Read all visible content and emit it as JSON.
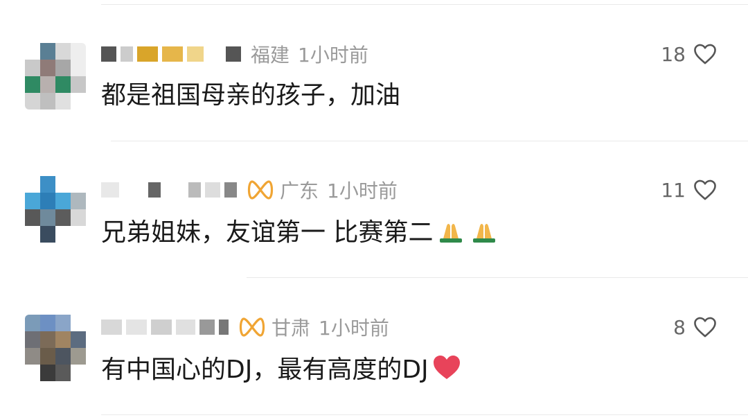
{
  "comments": [
    {
      "location": "福建",
      "time": "1小时前",
      "text": "都是祖国母亲的孩子，加油",
      "likes": "18",
      "has_badge": false,
      "emoji": "",
      "avatar_colors": [
        "#ffffff",
        "#5a7f94",
        "#d8d8d8",
        "#eeeeee",
        "#c9c9c9",
        "#8f7b78",
        "#a7a7a7",
        "#eeeeee",
        "#2f8a63",
        "#b8b0ae",
        "#2f8a63",
        "#c7c7c7",
        "#d5d5d5",
        "#bfbfbf",
        "#e0e0e0",
        "#ffffff"
      ]
    },
    {
      "location": "广东",
      "time": "1小时前",
      "text": "兄弟姐妹，友谊第一 比赛第二",
      "likes": "11",
      "has_badge": true,
      "emoji": "folded-hands",
      "avatar_colors": [
        "#ffffff",
        "#3d8fc6",
        "#ffffff",
        "#ffffff",
        "#4aa7d8",
        "#2d7eb7",
        "#4aa7d8",
        "#aeb8be",
        "#585858",
        "#6f8a9c",
        "#5c5c5c",
        "#d8d8d8",
        "#ffffff",
        "#3a4c5f",
        "#ffffff",
        "#ffffff"
      ]
    },
    {
      "location": "甘肃",
      "time": "1小时前",
      "text": "有中国心的DJ，最有高度的DJ",
      "likes": "8",
      "has_badge": true,
      "emoji": "heart",
      "avatar_colors": [
        "#7b9bb8",
        "#6d90c3",
        "#8aa5c8",
        "#ffffff",
        "#6e6f75",
        "#7c6b58",
        "#a08462",
        "#5c6c80",
        "#8f8b86",
        "#6a5c4a",
        "#4d5560",
        "#9d9a90",
        "#ffffff",
        "#3b3b3b",
        "#5a5a5a",
        "#ffffff"
      ]
    }
  ]
}
